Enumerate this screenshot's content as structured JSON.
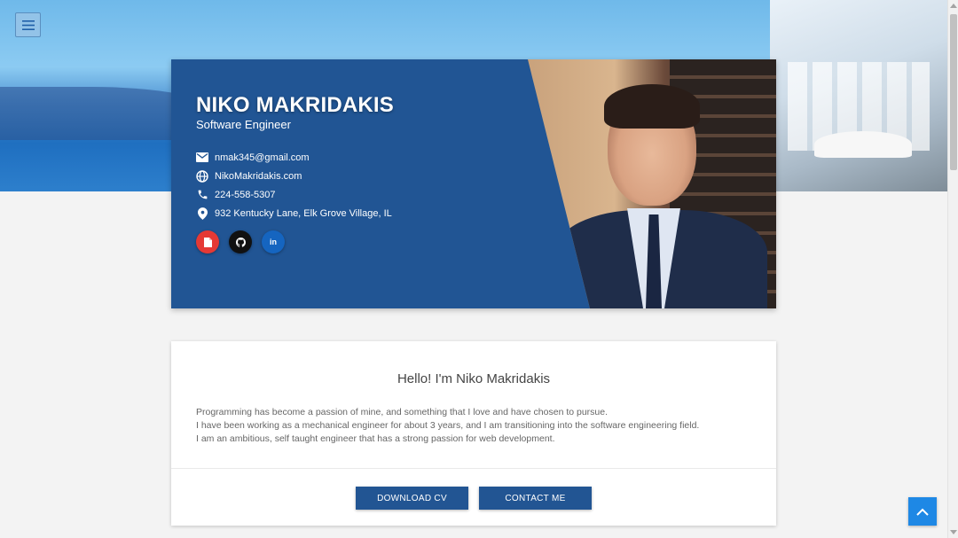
{
  "profile": {
    "name": "NIKO MAKRIDAKIS",
    "role": "Software Engineer",
    "email": "nmak345@gmail.com",
    "website": "NikoMakridakis.com",
    "phone": "224-558-5307",
    "address": "932 Kentucky Lane, Elk Grove Village, IL",
    "social": [
      {
        "name": "resume",
        "icon": "document-icon",
        "color": "#e53935"
      },
      {
        "name": "github",
        "icon": "github-icon",
        "color": "#111111"
      },
      {
        "name": "linkedin",
        "icon": "linkedin-icon",
        "color": "#1565c0",
        "glyph": "in"
      }
    ]
  },
  "about": {
    "title": "Hello! I'm Niko Makridakis",
    "lines": [
      "Programming has become a passion of mine, and something that I love and have chosen to pursue.",
      "I have been working as a mechanical engineer for about 3 years, and I am transitioning into the software engineering field.",
      "I am an ambitious, self taught engineer that has a strong passion for web development."
    ]
  },
  "actions": {
    "download_cv": "DOWNLOAD CV",
    "contact_me": "CONTACT ME"
  },
  "colors": {
    "card_blue": "#215594",
    "button_blue": "#225593",
    "scroll_top": "#1e88e5"
  }
}
